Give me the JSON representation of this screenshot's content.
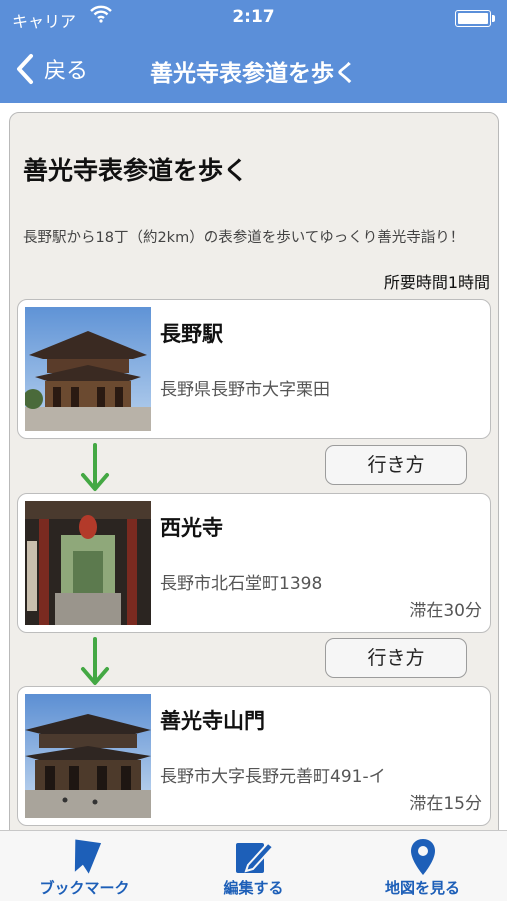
{
  "status_bar": {
    "carrier": "キャリア",
    "time": "2:17"
  },
  "nav": {
    "back_label": "戻る",
    "title": "善光寺表参道を歩く"
  },
  "route": {
    "title": "善光寺表参道を歩く",
    "description": "長野駅から18丁（約2km）の表参道を歩いてゆっくり善光寺詣り！",
    "duration": "所要時間1時間"
  },
  "spots": [
    {
      "name": "長野駅",
      "address": "長野県長野市大字栗田",
      "stay": ""
    },
    {
      "name": "西光寺",
      "address": "長野市北石堂町1398",
      "stay": "滞在30分"
    },
    {
      "name": "善光寺山門",
      "address": "長野市大字長野元善町491-イ",
      "stay": "滞在15分"
    }
  ],
  "directions_label": "行き方",
  "tabs": [
    {
      "label": "ブックマーク",
      "icon": "bookmark-icon"
    },
    {
      "label": "編集する",
      "icon": "edit-icon"
    },
    {
      "label": "地図を見る",
      "icon": "map-pin-icon"
    }
  ],
  "colors": {
    "accent": "#5b8fd9",
    "tab_tint": "#1d5fb8",
    "arrow": "#44a844"
  }
}
